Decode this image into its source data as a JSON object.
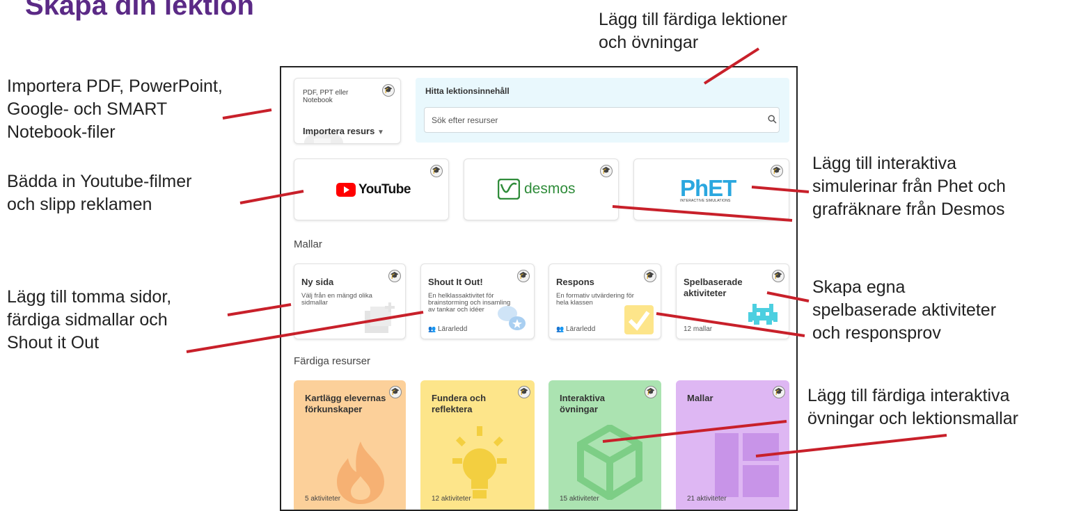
{
  "heading": "Skapa din lektion",
  "callouts": {
    "ready_lessons": "Lägg till färdiga lektioner\noch övningar",
    "import_files": "Importera PDF, PowerPoint,\nGoogle- och SMART\nNotebook-filer",
    "youtube": "Bädda in Youtube-filmer\noch slipp reklamen",
    "interactive_sims": "Lägg till interaktiva\nsimulerinar från Phet och\ngrafräknare från Desmos",
    "blank_pages": "Lägg till tomma sidor,\nfärdiga sidmallar och\nShout it Out",
    "game_based": "Skapa egna\nspelbaserade aktiviteter\noch responsprov",
    "ready_exercises": "Lägg till färdiga interaktiva\növningar och lektionsmallar"
  },
  "import_card": {
    "formats": "PDF, PPT eller Notebook",
    "title": "Importera resurs",
    "chevron": "▼"
  },
  "search": {
    "title": "Hitta lektionsinnehåll",
    "placeholder": "Sök efter resurser"
  },
  "integrations": {
    "youtube": "YouTube",
    "desmos": "desmos",
    "phet": "PhET",
    "phet_sub": "INTERACTIVE SIMULATIONS"
  },
  "templates": {
    "section": "Mallar",
    "items": [
      {
        "title": "Ny sida",
        "desc": "Välj från en mängd olika sidmallar",
        "meta": ""
      },
      {
        "title": "Shout It Out!",
        "desc": "En helklassaktivitet för brainstorming och insamling av tankar och idéer",
        "meta": "Lärarledd"
      },
      {
        "title": "Respons",
        "desc": "En formativ utvärdering för hela klassen",
        "meta": "Lärarledd"
      },
      {
        "title": "Spelbaserade aktiviteter",
        "desc": "",
        "meta": "12 mallar"
      }
    ]
  },
  "resources": {
    "section": "Färdiga resurser",
    "items": [
      {
        "title": "Kartlägg elevernas förkunskaper",
        "meta": "5 aktiviteter",
        "color": "#fcd09a"
      },
      {
        "title": "Fundera och reflektera",
        "meta": "12 aktiviteter",
        "color": "#fde58a"
      },
      {
        "title": "Interaktiva övningar",
        "meta": "15 aktiviteter",
        "color": "#abe3b1"
      },
      {
        "title": "Mallar",
        "meta": "21 aktiviteter",
        "color": "#deb7f3"
      }
    ]
  },
  "colors": {
    "heading": "#5b2a86",
    "annotation_line": "#c8202a",
    "youtube_red": "#ff0000",
    "desmos_green": "#2f8c3a"
  }
}
